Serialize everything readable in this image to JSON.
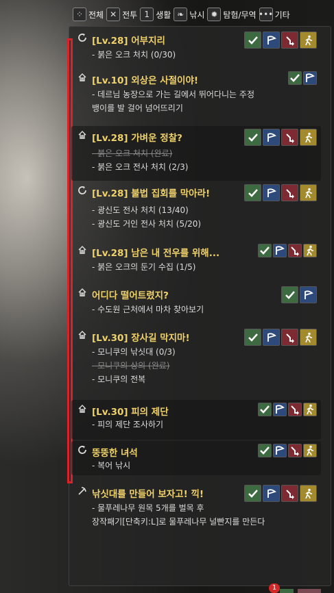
{
  "filters": [
    {
      "label": "전체",
      "icon": "all-filter-icon",
      "glyph": "⁘"
    },
    {
      "label": "전투",
      "icon": "crossed-swords-icon",
      "glyph": "✕"
    },
    {
      "label": "생활",
      "icon": "life-icon",
      "glyph": "1"
    },
    {
      "label": "낚시",
      "icon": "fish-icon",
      "glyph": "❧"
    },
    {
      "label": "탐험/무역",
      "icon": "compass-icon",
      "glyph": "✹"
    },
    {
      "label": "기타",
      "icon": "more-icon",
      "glyph": "•••"
    }
  ],
  "quests": [
    {
      "title": "[Lv.28] 어부지리",
      "icon": "quest-circle-icon",
      "objectives": [
        {
          "text": "- 붉은 오크 처치 (0/30)",
          "done": false
        }
      ]
    },
    {
      "title": "[Lv.10] 외상은 사절이야!",
      "icon": "quest-house-icon",
      "objectives": [
        {
          "text": "- 데르님 농장으로 가는 길에서 뛰어다니는 주정",
          "done": false
        },
        {
          "text": "뱅이를 발 걸어 넘어뜨리기",
          "done": false
        }
      ]
    },
    {
      "title": "[Lv.28] 가벼운 정찰?",
      "icon": "quest-house-icon",
      "objectives": [
        {
          "text": "- 붉은 오크 처치 (완료)",
          "done": true
        },
        {
          "text": "- 붉은 오크 전사 처치 (2/3)",
          "done": false
        }
      ]
    },
    {
      "title": "[Lv.28] 불법 집회를 막아라!",
      "icon": "quest-circle-icon",
      "objectives": [
        {
          "text": "- 광신도 전사 처치 (13/40)",
          "done": false
        },
        {
          "text": "- 광신도 거인 전사 처치 (5/20)",
          "done": false
        }
      ]
    },
    {
      "title": "[Lv.28] 남은 내 전우를 위해...",
      "icon": "quest-house-icon",
      "objectives": [
        {
          "text": "- 붉은 오크의 둔기 수집 (1/5)",
          "done": false
        }
      ]
    },
    {
      "title": "어디다 떨어트렸지?",
      "icon": "quest-house-icon",
      "objectives": [
        {
          "text": "- 수도원 근처에서 마차 찾아보기",
          "done": false
        }
      ]
    },
    {
      "title": "[Lv.30] 장사길 막지마!",
      "icon": "quest-house-icon",
      "objectives": [
        {
          "text": "- 모니쿠의 낚싯대 (0/3)",
          "done": false
        },
        {
          "text": "- 모니쿠의 상의 (완료)",
          "done": true
        },
        {
          "text": "- 모니쿠의 전복",
          "done": false
        }
      ]
    },
    {
      "title": "[Lv.30] 피의 제단",
      "icon": "quest-house-icon",
      "objectives": [
        {
          "text": "- 피의 제단 조사하기",
          "done": false
        }
      ]
    },
    {
      "title": "뚱뚱한 녀석",
      "icon": "quest-circle-icon",
      "objectives": [
        {
          "text": "- 복어 낚시",
          "done": false
        }
      ]
    },
    {
      "title": "낚싯대를 만들어 보자고! 끽!",
      "icon": "quest-pickaxe-icon",
      "objectives": [
        {
          "text": "- 물푸레나무 원목 5개를 벌목 후",
          "done": false
        },
        {
          "text": "장작패기[단축키:L]로 물푸레나무 널빤지를 만든다",
          "done": false
        }
      ]
    }
  ],
  "badge_count": "1"
}
